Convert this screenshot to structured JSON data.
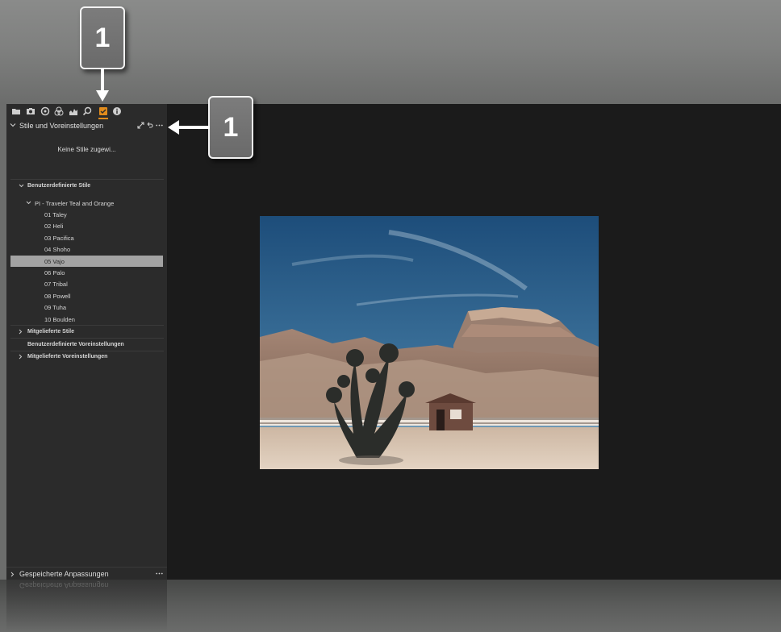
{
  "toolbar": {
    "icons": [
      "folder-icon",
      "camera-icon",
      "color-wheel-icon",
      "layers-icon",
      "histogram-icon",
      "search-icon",
      "styles-icon",
      "info-icon"
    ],
    "accent": "#e28c1c"
  },
  "section": {
    "title": "Stile und Voreinstellungen",
    "empty_text": "Keine Stile zugewi..."
  },
  "tree": {
    "user_styles": "Benutzerdefinierte Stile",
    "pack": "PI - Traveler Teal and Orange",
    "items": [
      "01 Taley",
      "02 Heli",
      "03 Pacifica",
      "04 Shoho",
      "05 Vajo",
      "06 Palo",
      "07 Tribal",
      "08 Powell",
      "09 Tuha",
      "10 Boulden"
    ],
    "selected_index": 4,
    "bundled_styles": "Mitgelieferte Stile",
    "user_presets": "Benutzerdefinierte Voreinstellungen",
    "bundled_presets": "Mitgelieferte Voreinstellungen"
  },
  "footer": {
    "title": "Gespeicherte Anpassungen",
    "reflection": "Gespeicherte Anpassungen"
  },
  "callouts": {
    "top": "1",
    "right": "1"
  }
}
